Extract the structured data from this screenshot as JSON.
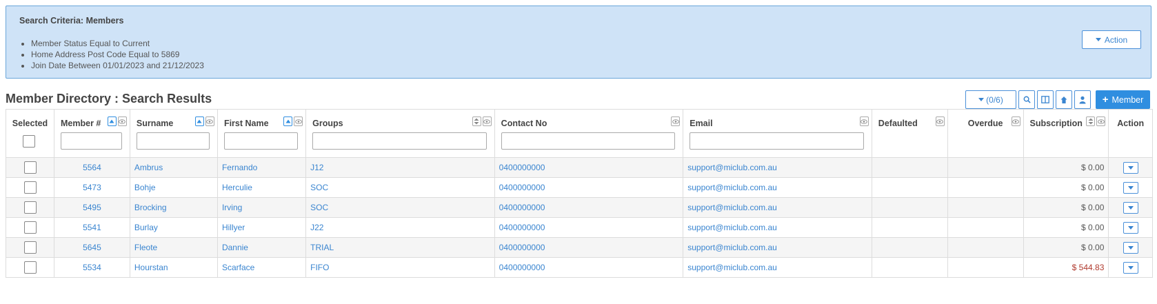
{
  "criteria": {
    "title": "Search Criteria: Members",
    "items": [
      "Member Status Equal to Current",
      "Home Address Post Code Equal to 5869",
      "Join Date Between 01/01/2023 and 21/12/2023"
    ],
    "action_label": "Action"
  },
  "page_title": "Member Directory : Search Results",
  "toolbar": {
    "count_label": "(0/6)",
    "add_member_label": "Member"
  },
  "columns": {
    "selected": "Selected",
    "member_no": "Member #",
    "surname": "Surname",
    "first_name": "First Name",
    "groups": "Groups",
    "contact_no": "Contact No",
    "email": "Email",
    "defaulted": "Defaulted",
    "overdue": "Overdue",
    "subscription": "Subscription",
    "action": "Action"
  },
  "rows": [
    {
      "member_no": "5564",
      "surname": "Ambrus",
      "first_name": "Fernando",
      "group": "J12",
      "contact": "0400000000",
      "email": "support@miclub.com.au",
      "defaulted": "",
      "overdue": "",
      "subscription": "$ 0.00"
    },
    {
      "member_no": "5473",
      "surname": "Bohje",
      "first_name": "Herculie",
      "group": "SOC",
      "contact": "0400000000",
      "email": "support@miclub.com.au",
      "defaulted": "",
      "overdue": "",
      "subscription": "$ 0.00"
    },
    {
      "member_no": "5495",
      "surname": "Brocking",
      "first_name": "Irving",
      "group": "SOC",
      "contact": "0400000000",
      "email": "support@miclub.com.au",
      "defaulted": "",
      "overdue": "",
      "subscription": "$ 0.00"
    },
    {
      "member_no": "5541",
      "surname": "Burlay",
      "first_name": "Hillyer",
      "group": "J22",
      "contact": "0400000000",
      "email": "support@miclub.com.au",
      "defaulted": "",
      "overdue": "",
      "subscription": "$ 0.00"
    },
    {
      "member_no": "5645",
      "surname": "Fleote",
      "first_name": "Dannie",
      "group": "TRIAL",
      "contact": "0400000000",
      "email": "support@miclub.com.au",
      "defaulted": "",
      "overdue": "",
      "subscription": "$ 0.00"
    },
    {
      "member_no": "5534",
      "surname": "Hourstan",
      "first_name": "Scarface",
      "group": "FIFO",
      "contact": "0400000000",
      "email": "support@miclub.com.au",
      "defaulted": "",
      "overdue": "",
      "subscription": "$ 544.83"
    }
  ],
  "colors": {
    "accent": "#2f8ee0",
    "panel_bg": "#cfe3f7",
    "link": "#3a85d0",
    "negative_amount": "#b03a2e"
  }
}
